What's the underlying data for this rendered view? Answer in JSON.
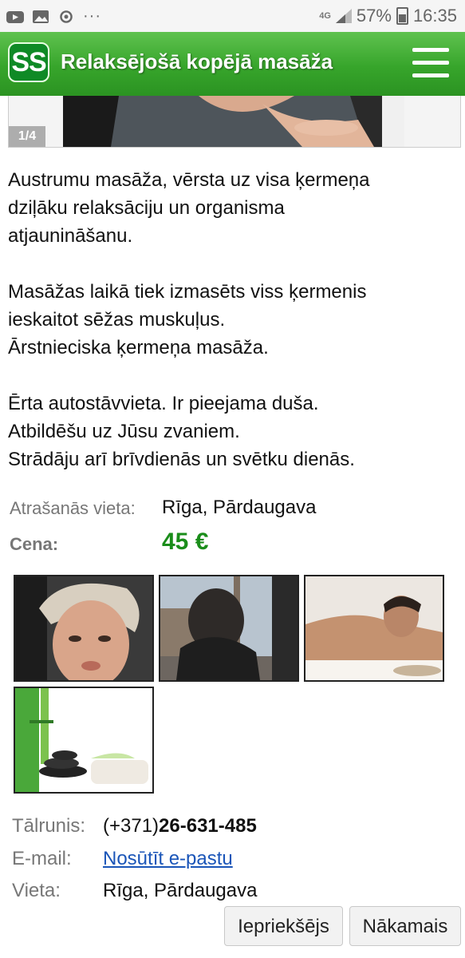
{
  "status_bar": {
    "network": "4G",
    "battery": "57%",
    "time": "16:35",
    "icons": [
      "youtube-icon",
      "gallery-icon",
      "sync-icon",
      "more-icon"
    ]
  },
  "header": {
    "logo": "SS",
    "title": "Relaksējošā kopējā masāža",
    "accent_color": "#3aa72e"
  },
  "gallery": {
    "counter": "1/4"
  },
  "description": {
    "paragraphs": [
      [
        "Austrumu masāža, vērsta uz visa ķermeņa",
        "dziļāku relaksāciju un organisma",
        "atjaunināšanu."
      ],
      [
        "Masāžas laikā tiek izmasēts viss ķermenis",
        "ieskaitot sēžas muskuļus.",
        "Ārstnieciska ķermeņa masāža."
      ],
      [
        "Ērta autostāvvieta. Ir pieejama duša.",
        "Atbildēšu uz Jūsu zvaniem.",
        "Strādāju arī brīvdienās un svētku dienās."
      ]
    ]
  },
  "details": {
    "location_label": "Atrašanās vieta:",
    "location_value": "Rīga, Pārdaugava",
    "price_label": "Cena:",
    "price_value": "45 €",
    "price_color": "#1a8d1a"
  },
  "contact": {
    "phone_label": "Tālrunis:",
    "phone_prefix": "(+371)",
    "phone_number": "26-631-485",
    "email_label": "E-mail:",
    "email_link": "Nosūtīt e-pastu",
    "place_label": "Vieta:",
    "place_value": "Rīga, Pārdaugava"
  },
  "nav": {
    "prev_label": "Iepriekšējs",
    "next_label": "Nākamais"
  }
}
